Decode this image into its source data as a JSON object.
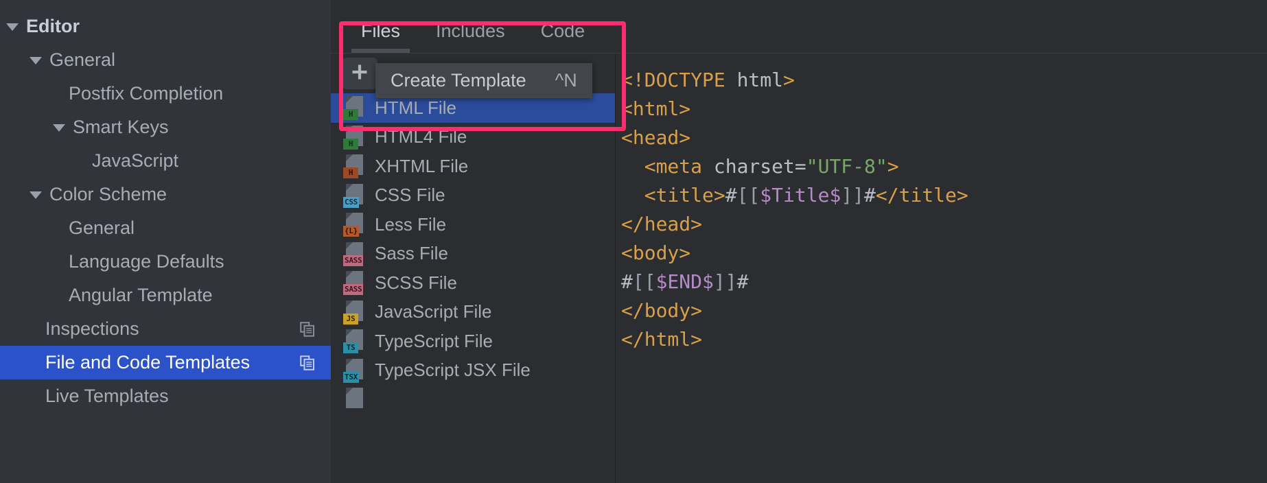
{
  "sidebar": {
    "items": [
      {
        "label": "Editor",
        "depth": 0,
        "twisty": "open",
        "bold": true,
        "selected": false,
        "copy_icon": false
      },
      {
        "label": "General",
        "depth": 1,
        "twisty": "open",
        "bold": false,
        "selected": false,
        "copy_icon": false
      },
      {
        "label": "Postfix Completion",
        "depth": 2,
        "twisty": "none",
        "bold": false,
        "selected": false,
        "copy_icon": false
      },
      {
        "label": "Smart Keys",
        "depth": 2,
        "twisty": "open",
        "bold": false,
        "selected": false,
        "copy_icon": false
      },
      {
        "label": "JavaScript",
        "depth": 3,
        "twisty": "none",
        "bold": false,
        "selected": false,
        "copy_icon": false
      },
      {
        "label": "Color Scheme",
        "depth": 1,
        "twisty": "open",
        "bold": false,
        "selected": false,
        "copy_icon": false
      },
      {
        "label": "General",
        "depth": 2,
        "twisty": "none",
        "bold": false,
        "selected": false,
        "copy_icon": false
      },
      {
        "label": "Language Defaults",
        "depth": 2,
        "twisty": "none",
        "bold": false,
        "selected": false,
        "copy_icon": false
      },
      {
        "label": "Angular Template",
        "depth": 2,
        "twisty": "none",
        "bold": false,
        "selected": false,
        "copy_icon": false
      },
      {
        "label": "Inspections",
        "depth": 1,
        "twisty": "none",
        "bold": false,
        "selected": false,
        "copy_icon": true
      },
      {
        "label": "File and Code Templates",
        "depth": 1,
        "twisty": "none",
        "bold": false,
        "selected": true,
        "copy_icon": true
      },
      {
        "label": "Live Templates",
        "depth": 1,
        "twisty": "none",
        "bold": false,
        "selected": false,
        "copy_icon": false
      }
    ]
  },
  "tabs": [
    {
      "label": "Files",
      "active": true
    },
    {
      "label": "Includes",
      "active": false
    },
    {
      "label": "Code",
      "active": false
    }
  ],
  "toolbar": {
    "buttons": [
      {
        "name": "add-template-button",
        "icon": "plus-icon",
        "hovered": true
      },
      {
        "name": "remove-template-button",
        "icon": "minus-icon",
        "hovered": false
      },
      {
        "name": "copy-template-button",
        "icon": "copy-icon",
        "hovered": false
      },
      {
        "name": "reset-template-button",
        "icon": "undo-icon",
        "hovered": false
      }
    ]
  },
  "tooltip": {
    "label": "Create Template",
    "shortcut": "^N"
  },
  "template_list": [
    {
      "label": "HTML File",
      "badge": "H",
      "badge_bg": "#2f7a3a",
      "badge_fg": "#0e2f14",
      "selected": true
    },
    {
      "label": "HTML4 File",
      "badge": "H",
      "badge_bg": "#2f7a3a",
      "badge_fg": "#0e2f14",
      "selected": false
    },
    {
      "label": "XHTML File",
      "badge": "H",
      "badge_bg": "#9c4a26",
      "badge_fg": "#2b1007",
      "selected": false
    },
    {
      "label": "CSS File",
      "badge": "CSS",
      "badge_bg": "#4c9cc4",
      "badge_fg": "#10303f",
      "selected": false
    },
    {
      "label": "Less File",
      "badge": "{L}",
      "badge_bg": "#b35a2c",
      "badge_fg": "#2d1206",
      "selected": false
    },
    {
      "label": "Sass File",
      "badge": "SASS",
      "badge_bg": "#c06a80",
      "badge_fg": "#3a1420",
      "selected": false
    },
    {
      "label": "SCSS File",
      "badge": "SASS",
      "badge_bg": "#c06a80",
      "badge_fg": "#3a1420",
      "selected": false
    },
    {
      "label": "JavaScript File",
      "badge": "JS",
      "badge_bg": "#c9a227",
      "badge_fg": "#33280a",
      "selected": false
    },
    {
      "label": "TypeScript File",
      "badge": "TS",
      "badge_bg": "#2c8fa8",
      "badge_fg": "#0b2a33",
      "selected": false
    },
    {
      "label": "TypeScript JSX File",
      "badge": "TSX",
      "badge_bg": "#2c8fa8",
      "badge_fg": "#0b2a33",
      "selected": false
    },
    {
      "label": "",
      "badge": "",
      "badge_bg": "#6c7480",
      "badge_fg": "#1b1d20",
      "selected": false
    }
  ],
  "code": {
    "lines": [
      [
        {
          "t": "<!DOCTYPE ",
          "c": "tag"
        },
        {
          "t": "html",
          "c": "attr"
        },
        {
          "t": ">",
          "c": "tag"
        }
      ],
      [
        {
          "t": "<html>",
          "c": "tag"
        }
      ],
      [
        {
          "t": "<head>",
          "c": "tag"
        }
      ],
      [
        {
          "t": "  <meta ",
          "c": "tag"
        },
        {
          "t": "charset=",
          "c": "attr"
        },
        {
          "t": "\"UTF-8\"",
          "c": "str"
        },
        {
          "t": ">",
          "c": "tag"
        }
      ],
      [
        {
          "t": "  <title>",
          "c": "tag"
        },
        {
          "t": "#",
          "c": "macro"
        },
        {
          "t": "[[",
          "c": "brk"
        },
        {
          "t": "$Title$",
          "c": "var"
        },
        {
          "t": "]]",
          "c": "brk"
        },
        {
          "t": "#",
          "c": "macro"
        },
        {
          "t": "</title>",
          "c": "tag"
        }
      ],
      [
        {
          "t": "</head>",
          "c": "tag"
        }
      ],
      [
        {
          "t": "<body>",
          "c": "tag"
        }
      ],
      [
        {
          "t": "#",
          "c": "macro"
        },
        {
          "t": "[[",
          "c": "brk"
        },
        {
          "t": "$END$",
          "c": "var"
        },
        {
          "t": "]]",
          "c": "brk"
        },
        {
          "t": "#",
          "c": "macro"
        }
      ],
      [
        {
          "t": "</body>",
          "c": "tag"
        }
      ],
      [
        {
          "t": "</html>",
          "c": "tag"
        }
      ]
    ]
  },
  "colors": {
    "sidebar_bg": "#31343b",
    "selection_blue": "#2c52c9",
    "list_selection_blue": "#2b4c9b",
    "highlight_pink": "#ff2d6f",
    "tooltip_bg": "#42454a",
    "editor_bg": "#2b2d30"
  }
}
